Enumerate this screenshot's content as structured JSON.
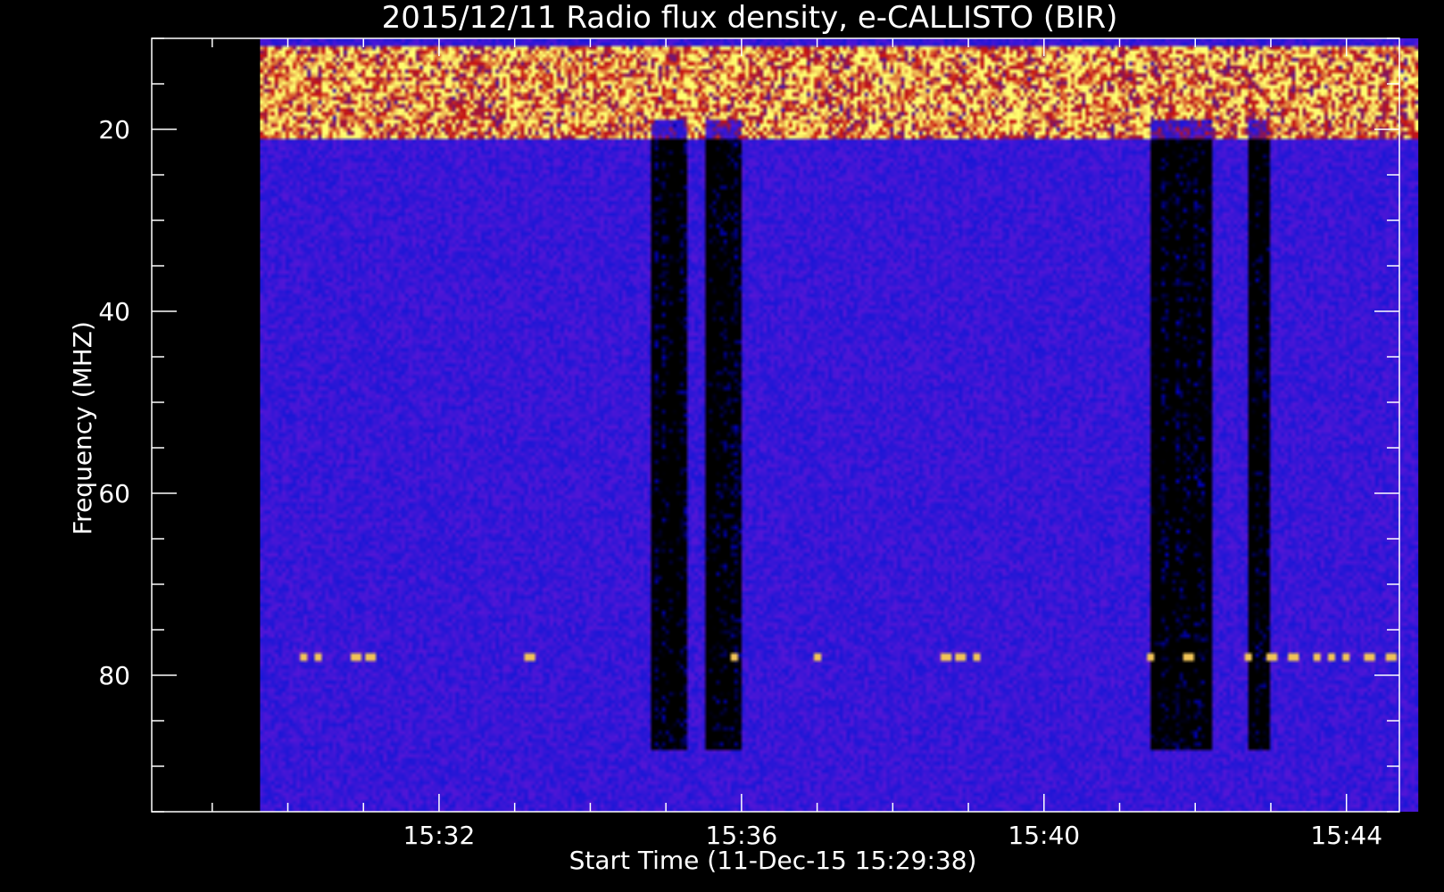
{
  "chart_data": {
    "type": "heatmap",
    "title": "2015/12/11  Radio flux density, e-CALLISTO (BIR)",
    "xlabel": "Start Time (11-Dec-15 15:29:38)",
    "ylabel": "Frequency (MHZ)",
    "xlim_minutes_after_15_29": [
      -0.8,
      15.7
    ],
    "ylim_mhz": [
      10,
      95
    ],
    "data_extent": {
      "time_start": "15:29:38",
      "time_end": "15:44:57",
      "freq_min_mhz": 10,
      "freq_max_mhz": 95
    },
    "x_ticks": [
      "15:32",
      "15:36",
      "15:40",
      "15:44"
    ],
    "x_tick_values_min": [
      3,
      7,
      11,
      15
    ],
    "y_ticks": [
      20,
      40,
      60,
      80
    ],
    "y_minor_step_mhz": 5,
    "colors": {
      "background": "#000000",
      "low": "#1a16d6",
      "mid": "#c81410",
      "high": "#ffff70"
    },
    "features": {
      "bright_band_mhz": [
        11,
        21
      ],
      "dark_lanes_min": [
        {
          "from": 5.8,
          "to": 6.3
        },
        {
          "from": 6.5,
          "to": 7.0
        },
        {
          "from": 12.4,
          "to": 13.2
        },
        {
          "from": 13.7,
          "to": 14.0
        }
      ],
      "rfi_line_mhz": 78,
      "rfi_spots_min": [
        1.2,
        1.4,
        1.9,
        2.1,
        4.2,
        6.9,
        8.0,
        9.7,
        9.9,
        10.1,
        12.4,
        12.9,
        13.7,
        14.0,
        14.3,
        14.6,
        14.8,
        15.0,
        15.3,
        15.6
      ]
    }
  }
}
